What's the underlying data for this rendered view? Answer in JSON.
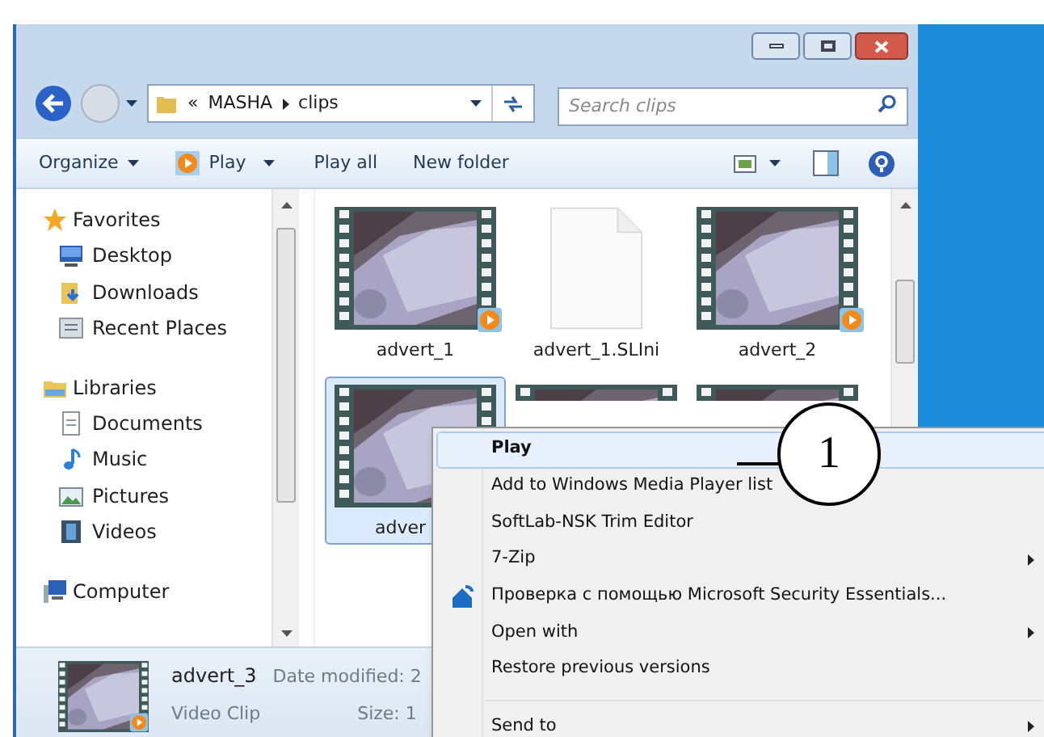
{
  "address": {
    "overflow": "«",
    "path": [
      "MASHA",
      "clips"
    ]
  },
  "search": {
    "placeholder": "Search clips"
  },
  "toolbar": [
    {
      "label": "Organize",
      "kind": "menu"
    },
    {
      "label": "Play",
      "kind": "play"
    },
    {
      "label": "Play all",
      "kind": "plain"
    },
    {
      "label": "New folder",
      "kind": "plain"
    }
  ],
  "nav": [
    {
      "label": "Favorites",
      "kind": "star",
      "children": [
        {
          "label": "Desktop",
          "kind": "desktop"
        },
        {
          "label": "Downloads",
          "kind": "downloads"
        },
        {
          "label": "Recent Places",
          "kind": "recent"
        }
      ]
    },
    {
      "label": "Libraries",
      "kind": "library",
      "children": [
        {
          "label": "Documents",
          "kind": "documents"
        },
        {
          "label": "Music",
          "kind": "music"
        },
        {
          "label": "Pictures",
          "kind": "pictures"
        },
        {
          "label": "Videos",
          "kind": "videos"
        }
      ]
    },
    {
      "label": "Computer",
      "kind": "computer"
    }
  ],
  "files": [
    {
      "name": "advert_1",
      "kind": "video",
      "selected": false
    },
    {
      "name": "advert_1.SLIni",
      "kind": "document",
      "selected": false
    },
    {
      "name": "advert_2",
      "kind": "video",
      "selected": false
    },
    {
      "name": "adver",
      "kind": "video",
      "selected": true
    },
    {
      "kind": "video",
      "selected": false
    },
    {
      "kind": "video",
      "selected": false
    }
  ],
  "context_menu": [
    {
      "label": "Play",
      "kind": "default",
      "selected": true,
      "submenu": false
    },
    {
      "label": "Add to Windows Media Player list",
      "kind": "plain",
      "selected": false,
      "submenu": false
    },
    {
      "label": "SoftLab-NSK Trim Editor",
      "kind": "plain",
      "selected": false,
      "submenu": false
    },
    {
      "label": "7-Zip",
      "kind": "plain",
      "selected": false,
      "submenu": true
    },
    {
      "label": "Проверка с помощью Microsoft Security Essentials...",
      "kind": "shield",
      "selected": false,
      "submenu": false
    },
    {
      "label": "Open with",
      "kind": "plain",
      "selected": false,
      "submenu": true
    },
    {
      "label": "Restore previous versions",
      "kind": "plain",
      "selected": false,
      "submenu": false
    },
    {
      "kind": "separator"
    },
    {
      "label": "Send to",
      "kind": "plain",
      "selected": false,
      "submenu": true
    }
  ],
  "callout": "1",
  "details": {
    "name": "advert_3",
    "type": "Video Clip",
    "date": "Date modified: 2",
    "size": "Size: 1"
  }
}
